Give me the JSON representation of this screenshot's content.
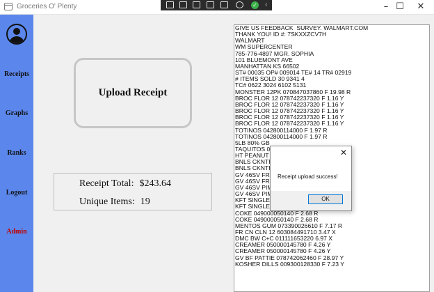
{
  "window": {
    "title": "Groceries O' Plenty",
    "controls": {
      "minimize": "–",
      "maximize": "☐",
      "close": "✕"
    }
  },
  "sidebar": {
    "items": [
      {
        "label": "Receipts"
      },
      {
        "label": "Graphs"
      },
      {
        "label": "Ranks"
      },
      {
        "label": "Logout"
      },
      {
        "label": "Admin"
      }
    ]
  },
  "main": {
    "upload_label": "Upload Receipt",
    "summary": {
      "total_label": "Receipt Total:",
      "total_value": "$243.64",
      "items_label": "Unique Items:",
      "items_value": "19"
    },
    "receipt_lines": [
      "GIVE US FEEDBACK  SURVEY. WALMART.COM",
      "THANK YOU! ID #: 7SKXXZCV7H",
      "WALMART",
      "WM SUPERCENTER",
      "785-776-4897 MGR. SOPHIA",
      "101 BLUEMONT AVE",
      "MANHATTAN KS 66502",
      "ST# 00035 OP# 009014 TE# 14 TR# 02919",
      "# ITEMS SOLD 30 9341 4",
      "TC# 0622 3024 6102 5131",
      "MONSTER 12PK 070847037860 F 19.98 R",
      "BROC FLOR 12 078742237320 F 1.16 Y",
      "BROC FLOR 12 078742237320 F 1.16 Y",
      "BROC FLOR 12 078742237320 F 1.16 Y",
      "BROC FLOR 12 078742237320 F 1.16 Y",
      "BROC FLOR 12 078742237320 F 1.16 Y",
      "TOTINOS 042800114000 F 1.97 R",
      "TOTINOS 042800114000 F 1.97 R",
      "5LB 80% GB",
      "TAQUITOS 07",
      "HT PEANUT B",
      "BNLS CKNTH",
      "BNLS CKNTH",
      "GV 46SV FRU",
      "GV 46SV FRU",
      "GV 46SV PIM",
      "GV 46SV PIM",
      "KFT SINGLES 021000604710 F 7.26 Y",
      "KFT SINGLES 021000604710 F 7.26 Y",
      "COKE 049000050140 F 2.68 R",
      "COKE 049000050140 F 2.68 R",
      "MENTOS GUM 073390026610 F 7.17 R",
      "FR CN CLN 12 603084491710 3.47 X",
      "DMC BW C+C 011111653220 6.97 X",
      "CREAMER 050000145780 F 4.26 Y",
      "CREAMER 050000145780 F 4.26 Y",
      "GV BF PATTIE 078742062460 F 28.97 Y",
      "KOSHER DILLS 009300128330 F 7.23 Y"
    ]
  },
  "dialog": {
    "message": "Receipt upload success!",
    "ok_label": "OK",
    "close_glyph": "✕"
  }
}
